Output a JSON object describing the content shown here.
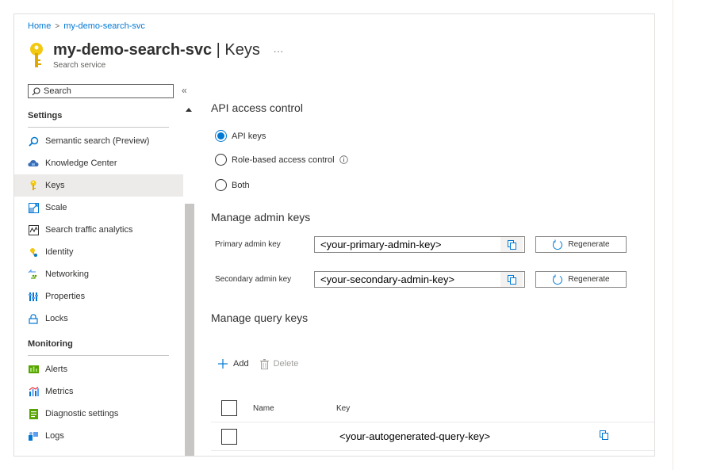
{
  "breadcrumb": [
    {
      "label": "Home"
    },
    {
      "label": "my-demo-search-svc"
    }
  ],
  "breadcrumb_separator": ">",
  "header": {
    "resource_name": "my-demo-search-svc",
    "separator": "|",
    "page_name": "Keys",
    "subtitle": "Search service",
    "more_label": "..."
  },
  "search": {
    "placeholder": "Search",
    "collapse_label": "«"
  },
  "sidebar": {
    "settings_header": "Settings",
    "settings_items": [
      {
        "label": "Semantic search (Preview)",
        "icon": "magnifier-icon"
      },
      {
        "label": "Knowledge Center",
        "icon": "cloud-icon"
      },
      {
        "label": "Keys",
        "icon": "key-icon",
        "active": true
      },
      {
        "label": "Scale",
        "icon": "scale-icon"
      },
      {
        "label": "Search traffic analytics",
        "icon": "analytics-icon"
      },
      {
        "label": "Identity",
        "icon": "identity-key-icon"
      },
      {
        "label": "Networking",
        "icon": "networking-icon"
      },
      {
        "label": "Properties",
        "icon": "properties-icon"
      },
      {
        "label": "Locks",
        "icon": "lock-icon"
      }
    ],
    "monitoring_header": "Monitoring",
    "monitoring_items": [
      {
        "label": "Alerts",
        "icon": "alerts-icon"
      },
      {
        "label": "Metrics",
        "icon": "metrics-icon"
      },
      {
        "label": "Diagnostic settings",
        "icon": "diagnostic-icon"
      },
      {
        "label": "Logs",
        "icon": "logs-icon"
      }
    ]
  },
  "api_access": {
    "heading": "API access control",
    "options": [
      {
        "label": "API keys",
        "checked": true
      },
      {
        "label": "Role-based access control",
        "checked": false
      },
      {
        "label": "Both",
        "checked": false
      }
    ]
  },
  "admin_keys": {
    "heading": "Manage admin keys",
    "primary_label": "Primary admin key",
    "primary_value": "<your-primary-admin-key>",
    "secondary_label": "Secondary admin key",
    "secondary_value": "<your-secondary-admin-key>",
    "regenerate_label": "Regenerate"
  },
  "query_keys": {
    "heading": "Manage query keys",
    "add_label": "Add",
    "delete_label": "Delete",
    "columns": [
      "Name",
      "Key"
    ],
    "rows": [
      {
        "name": "",
        "key": "<your-autogenerated-query-key>"
      }
    ]
  },
  "colors": {
    "accent": "#0078d4",
    "key_icon": "#f2c811",
    "active_bg": "#edebe9"
  }
}
